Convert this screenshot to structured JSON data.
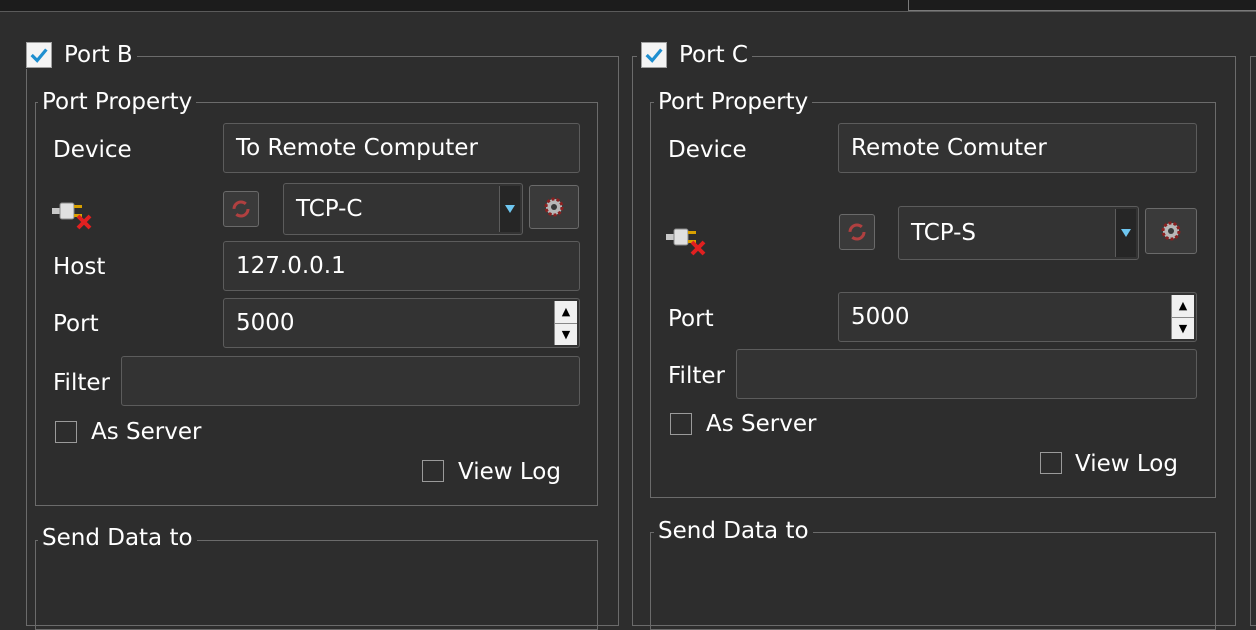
{
  "panels": [
    {
      "title": "Port B",
      "enabled": true,
      "port_property": {
        "legend": "Port Property",
        "device_label": "Device",
        "device_value": "To Remote Computer",
        "connection_type": "TCP-C",
        "host_label": "Host",
        "host_value": "127.0.0.1",
        "port_label": "Port",
        "port_value": "5000",
        "filter_label": "Filter",
        "filter_value": "",
        "as_server_label": "As Server",
        "as_server_checked": false,
        "view_log_label": "View Log",
        "view_log_checked": false
      },
      "send_data": {
        "legend": "Send Data to"
      }
    },
    {
      "title": "Port C",
      "enabled": true,
      "port_property": {
        "legend": "Port Property",
        "device_label": "Device",
        "device_value": "Remote Comuter",
        "connection_type": "TCP-S",
        "port_label": "Port",
        "port_value": "5000",
        "filter_label": "Filter",
        "filter_value": "",
        "as_server_label": "As Server",
        "as_server_checked": false,
        "view_log_label": "View Log",
        "view_log_checked": false
      },
      "send_data": {
        "legend": "Send Data to"
      }
    }
  ],
  "icons": {
    "connection_status": "disconnected-plug-icon",
    "refresh": "refresh-icon",
    "settings": "gear-icon",
    "dropdown": "triangle-down-icon"
  },
  "colors": {
    "background": "#2d2d2d",
    "check_mark": "#1e8fd0",
    "dropdown_arrow": "#6ec6f0",
    "refresh_red": "#b04040",
    "error_x": "#e02020"
  }
}
